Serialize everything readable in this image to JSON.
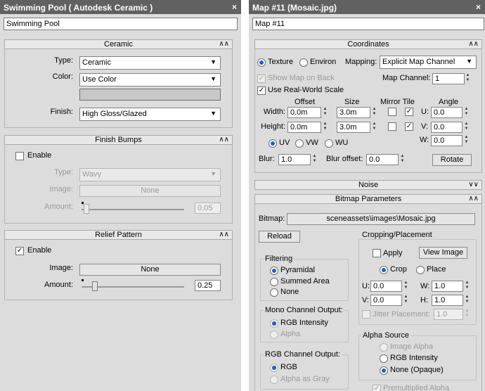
{
  "left_panel": {
    "title": "Swimming Pool  ( Autodesk Ceramic )",
    "close_glyph": "×",
    "name_value": "Swimming Pool",
    "ceramic": {
      "header": "Ceramic",
      "type_label": "Type:",
      "type_value": "Ceramic",
      "color_label": "Color:",
      "color_value": "Use Color",
      "finish_label": "Finish:",
      "finish_value": "High Gloss/Glazed"
    },
    "finish_bumps": {
      "header": "Finish Bumps",
      "enable_label": "Enable",
      "enable_checked": false,
      "type_label": "Type:",
      "type_value": "Wavy",
      "image_label": "Image:",
      "image_value": "None",
      "amount_label": "Amount:",
      "amount_value": "0.05"
    },
    "relief_pattern": {
      "header": "Relief Pattern",
      "enable_label": "Enable",
      "enable_checked": true,
      "image_label": "Image:",
      "image_value": "None",
      "amount_label": "Amount:",
      "amount_value": "0.25"
    }
  },
  "right_panel": {
    "title": "Map #11 (Mosaic.jpg)",
    "close_glyph": "×",
    "name_value": "Map #11",
    "coordinates": {
      "header": "Coordinates",
      "texture_label": "Texture",
      "environ_label": "Environ",
      "mapping_label": "Mapping:",
      "mapping_value": "Explicit Map Channel",
      "show_map_label": "Show Map on Back",
      "map_channel_label": "Map Channel:",
      "map_channel_value": "1",
      "real_world_label": "Use Real-World Scale",
      "offset_label": "Offset",
      "size_label": "Size",
      "mirror_tile_label": "Mirror Tile",
      "angle_label": "Angle",
      "width_label": "Width:",
      "height_label": "Height:",
      "offset_width": "0.0m",
      "offset_height": "0.0m",
      "size_width": "3.0m",
      "size_height": "3.0m",
      "u_label": "U:",
      "v_label": "V:",
      "w_label": "W:",
      "angle_u": "0.0",
      "angle_v": "0.0",
      "angle_w": "0.0",
      "uv_label": "UV",
      "vw_label": "VW",
      "wu_label": "WU",
      "blur_label": "Blur:",
      "blur_value": "1.0",
      "blur_offset_label": "Blur offset:",
      "blur_offset_value": "0.0",
      "rotate_label": "Rotate"
    },
    "noise": {
      "header": "Noise"
    },
    "bitmap_parameters": {
      "header": "Bitmap Parameters",
      "bitmap_label": "Bitmap:",
      "bitmap_path": "sceneassets\\images\\Mosaic.jpg",
      "reload_label": "Reload",
      "cropping_title": "Cropping/Placement",
      "apply_label": "Apply",
      "view_image_label": "View Image",
      "crop_label": "Crop",
      "place_label": "Place",
      "u_label": "U:",
      "v_label": "V:",
      "w_label": "W:",
      "h_label": "H:",
      "u_value": "0.0",
      "v_value": "0.0",
      "w_value": "1.0",
      "h_value": "1.0",
      "jitter_label": "Jitter Placement:",
      "jitter_value": "1.0",
      "filtering_title": "Filtering",
      "pyramidal_label": "Pyramidal",
      "summed_area_label": "Summed Area",
      "none_label": "None",
      "mono_title": "Mono Channel Output:",
      "rgb_intensity_label": "RGB Intensity",
      "alpha_label": "Alpha",
      "alpha_source_title": "Alpha Source",
      "image_alpha_label": "Image Alpha",
      "alpha_rgb_intensity_label": "RGB Intensity",
      "none_opaque_label": "None (Opaque)",
      "rgb_output_title": "RGB Channel Output:",
      "rgb_label": "RGB",
      "alpha_as_gray_label": "Alpha as Gray",
      "premultiplied_label": "Premultiplied Alpha"
    }
  },
  "colors": {
    "titlebar": "#616161",
    "panel": "#dcdcdc",
    "radio_dot": "#1f5fbf",
    "swatch": "#c8c8c8"
  }
}
